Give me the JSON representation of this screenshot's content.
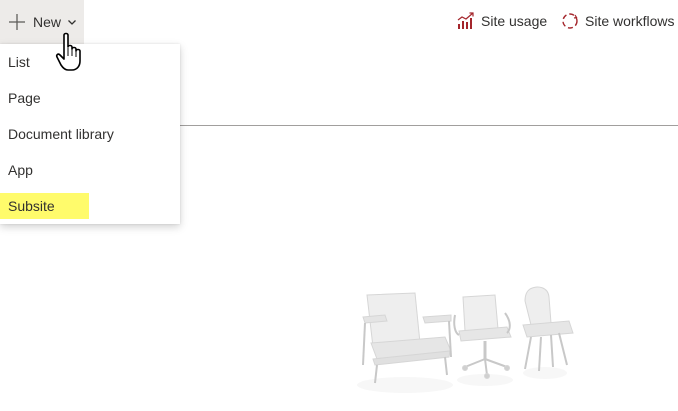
{
  "toolbar": {
    "new_label": "New",
    "site_usage_label": "Site usage",
    "site_workflows_label": "Site workflows"
  },
  "new_menu": {
    "items": [
      {
        "label": "List"
      },
      {
        "label": "Page"
      },
      {
        "label": "Document library"
      },
      {
        "label": "App"
      },
      {
        "label": "Subsite",
        "highlighted": true
      }
    ]
  },
  "colors": {
    "accent": "#a4262c",
    "highlight": "#fffb6b",
    "button_bg": "#edebe9"
  },
  "icons": {
    "new": "plus-icon",
    "dropdown": "chevron-down-icon",
    "cursor": "hand-pointer-icon",
    "site_usage": "bar-chart-icon",
    "site_workflows": "workflow-cycle-icon",
    "empty_state": "furniture-illustration"
  }
}
